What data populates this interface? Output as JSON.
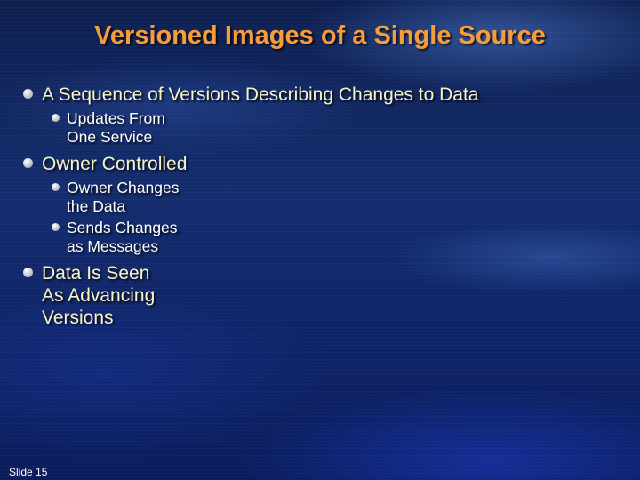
{
  "slide": {
    "title": "Versioned Images of a Single Source",
    "bullets": [
      {
        "text": "A Sequence of Versions Describing Changes to Data",
        "sub": [
          "Updates From\nOne Service"
        ]
      },
      {
        "text": "Owner Controlled",
        "sub": [
          "Owner Changes\nthe Data",
          "Sends Changes\nas Messages"
        ]
      },
      {
        "text": "Data Is Seen\nAs Advancing\nVersions",
        "sub": []
      }
    ],
    "slide_number_label": "Slide 15"
  },
  "colors": {
    "title": "#f59c3c",
    "level1_text": "#f6f4c8",
    "level2_text": "#ffffff",
    "background": "#142d6e"
  }
}
